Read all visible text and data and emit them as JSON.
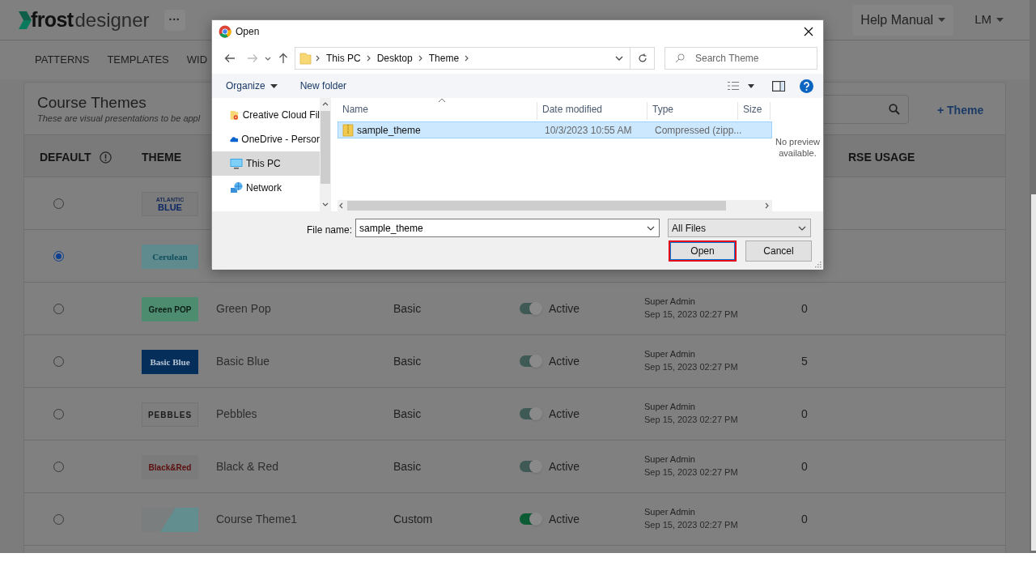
{
  "app": {
    "logo_brand": "frost",
    "logo_product": "designer",
    "more_button": "···",
    "help_menu": "Help Manual",
    "user_menu": "LM"
  },
  "tabs": [
    "PATTERNS",
    "TEMPLATES",
    "WID"
  ],
  "card": {
    "title": "Course Themes",
    "subtitle": "These are visual presentations to be appl",
    "add_button": "+ Theme"
  },
  "table": {
    "columns": [
      {
        "label": "DEFAULT",
        "info": true
      },
      {
        "label": "THEME",
        "info": false
      },
      {
        "label": "RSE USAGE",
        "info": false
      }
    ],
    "rows": [
      {
        "selected": false,
        "thumbnail": {
          "kind": "atlantic",
          "lines": [
            "ATLANTIC",
            "BLUE"
          ]
        }
      },
      {
        "selected": true,
        "thumbnail": {
          "kind": "cerulean",
          "lines": [
            "Cerulean"
          ]
        }
      },
      {
        "selected": false,
        "thumbnail": {
          "kind": "greenpop",
          "lines": [
            "Green POP"
          ]
        },
        "name": "Green Pop",
        "type": "Basic",
        "status": "Active",
        "on": true,
        "disabled": true,
        "updated_by": "Super Admin",
        "updated_at": "Sep 15, 2023 02:27 PM",
        "usage": "0"
      },
      {
        "selected": false,
        "thumbnail": {
          "kind": "basicblue",
          "lines": [
            "Basic Blue"
          ]
        },
        "name": "Basic Blue",
        "type": "Basic",
        "status": "Active",
        "on": true,
        "disabled": true,
        "updated_by": "Super Admin",
        "updated_at": "Sep 15, 2023 02:27 PM",
        "usage": "5"
      },
      {
        "selected": false,
        "thumbnail": {
          "kind": "pebbles",
          "lines": [
            "PEBBLES"
          ]
        },
        "name": "Pebbles",
        "type": "Basic",
        "status": "Active",
        "on": true,
        "disabled": true,
        "updated_by": "Super Admin",
        "updated_at": "Sep 15, 2023 02:27 PM",
        "usage": "0"
      },
      {
        "selected": false,
        "thumbnail": {
          "kind": "blackred",
          "lines": [
            "Black&Red"
          ]
        },
        "name": "Black & Red",
        "type": "Basic",
        "status": "Active",
        "on": true,
        "disabled": true,
        "updated_by": "Super Admin",
        "updated_at": "Sep 15, 2023 02:27 PM",
        "usage": "0"
      },
      {
        "selected": false,
        "thumbnail": {
          "kind": "custom"
        },
        "name": "Course Theme1",
        "type": "Custom",
        "status": "Active",
        "on": true,
        "disabled": false,
        "updated_by": "Super Admin",
        "updated_at": "Sep 15, 2023 02:27 PM",
        "usage": "0"
      }
    ]
  },
  "dialog": {
    "title": "Open",
    "breadcrumb": [
      "This PC",
      "Desktop",
      "Theme"
    ],
    "search_placeholder": "Search Theme",
    "toolbar": [
      {
        "label": "Organize",
        "dropdown": true
      },
      {
        "label": "New folder",
        "dropdown": false
      }
    ],
    "nav_items": [
      {
        "kind": "creative-cloud",
        "label": "Creative Cloud Fil",
        "selected": false
      },
      {
        "kind": "onedrive",
        "label": "OneDrive - Persor",
        "selected": false
      },
      {
        "kind": "pc",
        "label": "This PC",
        "selected": true
      },
      {
        "kind": "network",
        "label": "Network",
        "selected": false
      }
    ],
    "columns": [
      "Name",
      "Date modified",
      "Type",
      "Size"
    ],
    "files": [
      {
        "name": "sample_theme",
        "modified": "10/3/2023 10:55 AM",
        "type": "Compressed (zipp...",
        "selected": true
      }
    ],
    "preview_text": "No preview available.",
    "file_name_label": "File name:",
    "file_name": "sample_theme",
    "filter": "All Files",
    "buttons": [
      {
        "label": "Open",
        "highlighted": true
      },
      {
        "label": "Cancel",
        "highlighted": false
      }
    ]
  }
}
